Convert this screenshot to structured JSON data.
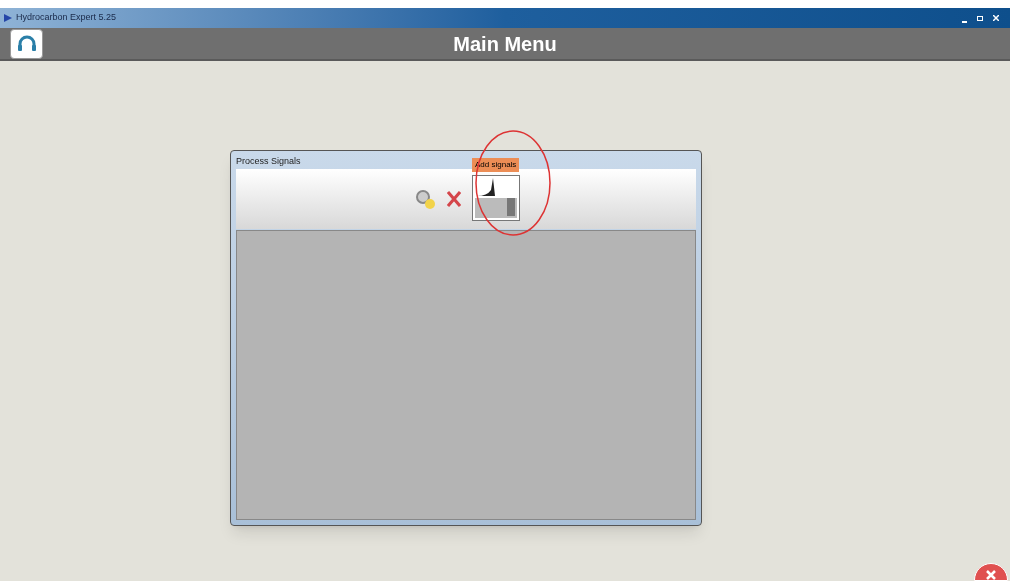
{
  "window": {
    "title": "Hydrocarbon Expert 5.25"
  },
  "header": {
    "title": "Main Menu"
  },
  "dialog": {
    "title": "Process Signals",
    "tooltip": "Add signals"
  }
}
